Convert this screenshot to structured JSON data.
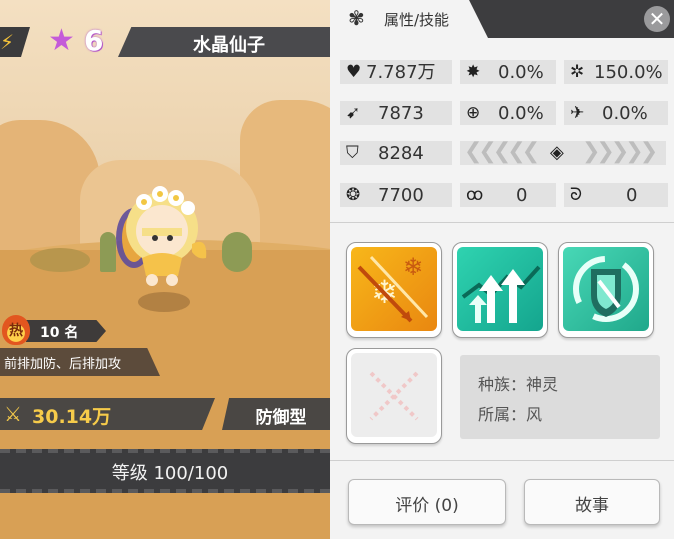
{
  "hero": {
    "star_icon": "star-icon",
    "star_level": "6",
    "name": "水晶仙子",
    "hot_label": "热",
    "rank": "10 名",
    "position_desc": "前排加防、后排加攻",
    "power": "30.14万",
    "type": "防御型",
    "level": "等级 100/100"
  },
  "panel": {
    "tab_label": "属性/技能",
    "stats": {
      "hp": "7.787万",
      "crit": "0.0%",
      "crit_damage": "150.0%",
      "attack": "7873",
      "hit": "0.0%",
      "dodge": "0.0%",
      "defense": "8284",
      "speed": "7700",
      "stat_a": "0",
      "stat_b": "0"
    },
    "skills": [
      {
        "icon": "ice-arrows-skill-icon",
        "color": "#f0a51a"
      },
      {
        "icon": "arrows-up-skill-icon",
        "color": "#1fbf9f"
      },
      {
        "icon": "shield-skill-icon",
        "color": "#2fc3a0"
      },
      {
        "icon": "empty-skill-slot-icon",
        "color": "#ededed"
      }
    ],
    "race_label": "种族：神灵",
    "faction_label": "所属：风",
    "rate_button": "评价 (0)",
    "story_button": "故事"
  }
}
